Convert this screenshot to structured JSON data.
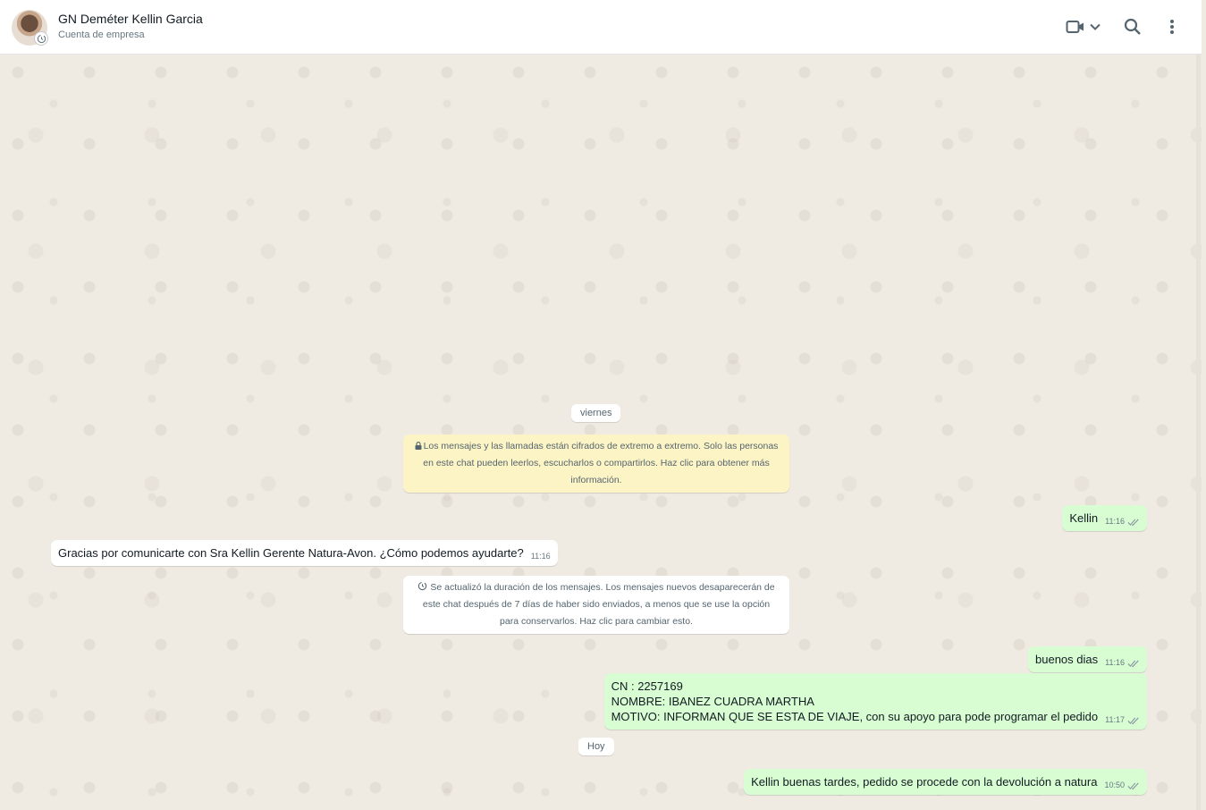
{
  "header": {
    "contact_name": "GN Deméter Kellin Garcia",
    "contact_sub": "Cuenta de empresa",
    "icons": [
      "video-call-icon",
      "chevron-down-icon",
      "search-icon",
      "menu-dots-icon"
    ]
  },
  "colors": {
    "outgoing_bubble": "#d9fdd3",
    "incoming_bubble": "#ffffff",
    "encryption_notice": "#fdf4c5",
    "chat_background": "#efeae2",
    "tick_color": "#8696a0"
  },
  "chat": {
    "date_viernes": "viernes",
    "encryption_notice": "Los mensajes y las llamadas están cifrados de extremo a extremo. Solo las personas en este chat pueden leerlos, escucharlos o compartirlos. Haz clic para obtener más información.",
    "msg_kellin": {
      "text": "Kellin",
      "time": "11:16"
    },
    "msg_greeting": {
      "text": "Gracias por comunicarte con Sra Kellin Gerente Natura-Avon. ¿Cómo podemos ayudarte?",
      "time": "11:16"
    },
    "timer_notice": "Se actualizó la duración de los mensajes. Los mensajes nuevos desaparecerán de este chat después de 7 días de haber sido enviados, a menos que se use la opción para conservarlos. Haz clic para cambiar esto.",
    "msg_buenos": {
      "text": "buenos dias",
      "time": "11:16"
    },
    "msg_cn": {
      "line1": "CN : 2257169",
      "line2": "NOMBRE: IBANEZ CUADRA MARTHA",
      "line3": "MOTIVO: INFORMAN QUE SE ESTA DE VIAJE, con su apoyo para pode programar el pedido",
      "time": "11:17"
    },
    "date_hoy": "Hoy",
    "msg_tardes": {
      "text": "Kellin buenas tardes, pedido se procede con la devolución a natura",
      "time": "10:50"
    }
  }
}
